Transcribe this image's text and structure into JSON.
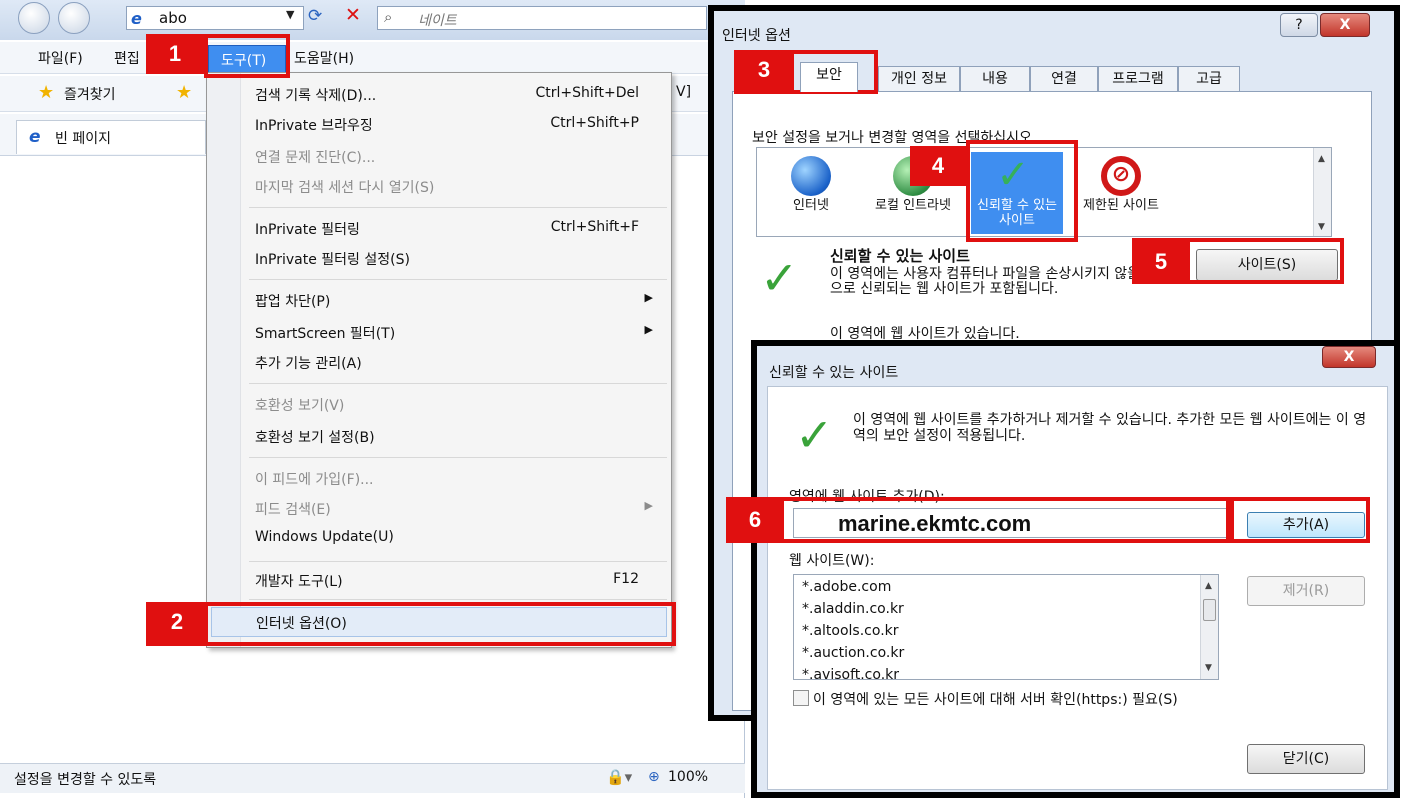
{
  "browser": {
    "address_text": "abo",
    "search_placeholder": "네이트",
    "menus": [
      "파일(F)",
      "편집",
      "도구(T)",
      "도움말(H)"
    ],
    "favorites_label": "즐겨찾기",
    "favorites_suffix": "V]",
    "tab_label": "빈 페이지",
    "status_text": "설정을 변경할 수 있도록",
    "zoom": "100%"
  },
  "tools_menu": {
    "items": [
      {
        "label": "검색 기록 삭제(D)...",
        "shortcut": "Ctrl+Shift+Del",
        "enabled": true
      },
      {
        "label": "InPrivate 브라우징",
        "shortcut": "Ctrl+Shift+P",
        "enabled": true
      },
      {
        "label": "연결 문제 진단(C)...",
        "shortcut": "",
        "enabled": false
      },
      {
        "label": "마지막 검색 세션 다시 열기(S)",
        "shortcut": "",
        "enabled": false
      },
      {
        "label": "InPrivate 필터링",
        "shortcut": "Ctrl+Shift+F",
        "enabled": true
      },
      {
        "label": "InPrivate 필터링 설정(S)",
        "shortcut": "",
        "enabled": true
      },
      {
        "label": "팝업 차단(P)",
        "shortcut": "▶",
        "enabled": true
      },
      {
        "label": "SmartScreen 필터(T)",
        "shortcut": "▶",
        "enabled": true
      },
      {
        "label": "추가 기능 관리(A)",
        "shortcut": "",
        "enabled": true
      },
      {
        "label": "호환성 보기(V)",
        "shortcut": "",
        "enabled": false
      },
      {
        "label": "호환성 보기 설정(B)",
        "shortcut": "",
        "enabled": true
      },
      {
        "label": "이 피드에 가입(F)...",
        "shortcut": "",
        "enabled": false
      },
      {
        "label": "피드 검색(E)",
        "shortcut": "▶",
        "enabled": false
      },
      {
        "label": "Windows Update(U)",
        "shortcut": "",
        "enabled": true
      },
      {
        "label": "개발자 도구(L)",
        "shortcut": "F12",
        "enabled": true
      },
      {
        "label": "인터넷 옵션(O)",
        "shortcut": "",
        "enabled": true
      }
    ]
  },
  "internet_options": {
    "title": "인터넷 옵션",
    "help_button": "?",
    "close_button": "X",
    "tabs": [
      "보안",
      "개인 정보",
      "내용",
      "연결",
      "프로그램",
      "고급"
    ],
    "prompt": "보안 설정을 보거나 변경할 영역을 선택하십시오.",
    "zones": [
      {
        "label": "인터넷"
      },
      {
        "label": "로컬 인트라넷"
      },
      {
        "label": "신뢰할 수 있는 사이트"
      },
      {
        "label": "제한된 사이트"
      }
    ],
    "zone_title": "신뢰할 수 있는 사이트",
    "zone_desc": "이 영역에는 사용자 컴퓨터나 파일을 손상시키지 않을 것으로 신뢰되는 웹 사이트가 포함됩니다.",
    "zone_has_sites": "이 영역에 웹 사이트가 있습니다.",
    "sites_button": "사이트(S)"
  },
  "trusted_sites": {
    "title": "신뢰할 수 있는 사이트",
    "close_button": "X",
    "description": "이 영역에 웹 사이트를 추가하거나 제거할 수 있습니다. 추가한 모든 웹 사이트에는 이 영역의 보안 설정이 적용됩니다.",
    "add_label": "영역에 웹 사이트 추가(D):",
    "add_value": "marine.ekmtc.com",
    "add_button": "추가(A)",
    "list_label": "웹 사이트(W):",
    "sites": [
      "*.adobe.com",
      "*.aladdin.co.kr",
      "*.altools.co.kr",
      "*.auction.co.kr",
      "*.avisoft.co.kr"
    ],
    "remove_button": "제거(R)",
    "https_label": "이 영역에 있는 모든 사이트에 대해 서버 확인(https:) 필요(S)",
    "close_label": "닫기(C)"
  },
  "badges": [
    "1",
    "2",
    "3",
    "4",
    "5",
    "6"
  ],
  "colors": {
    "annotation_red": "#e01010",
    "menu_highlight": "#3f8ef0",
    "check_green": "#3aa33a"
  }
}
